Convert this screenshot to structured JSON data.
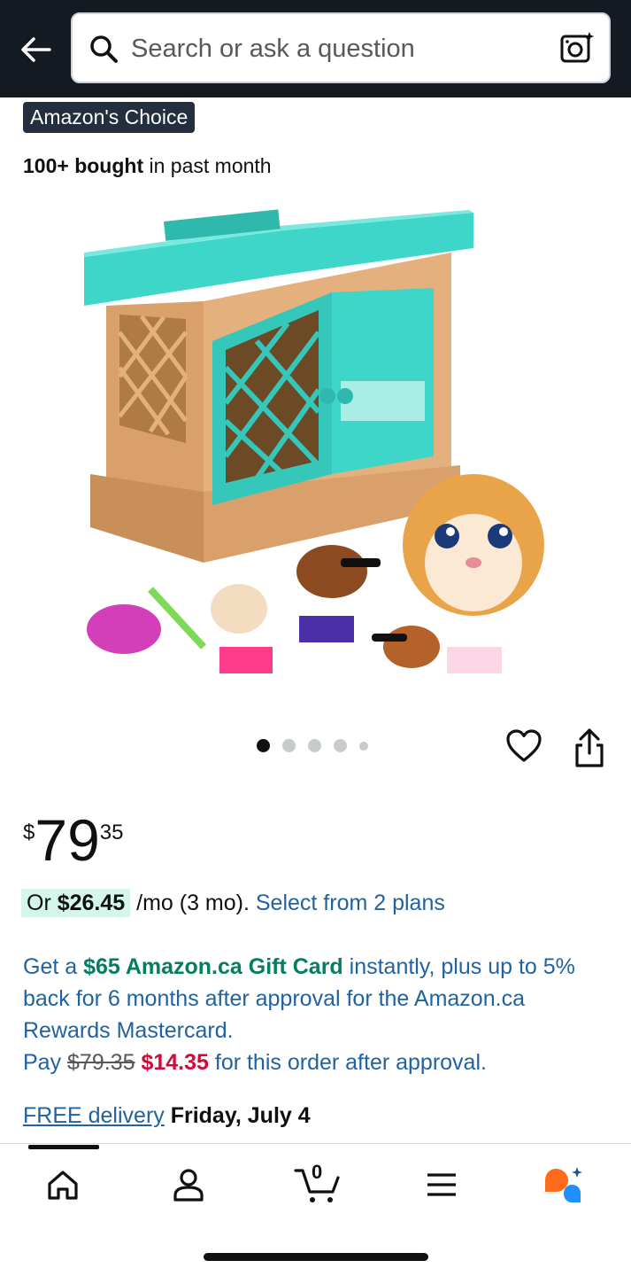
{
  "header": {
    "search_placeholder": "Search or ask a question",
    "background": "#131a22"
  },
  "product": {
    "badge": "Amazon's Choice",
    "bought_strong": "100+ bought",
    "bought_rest": " in past month",
    "image_alt": "Toy guinea pig hutch playset with plush guinea pigs and accessories",
    "carousel": {
      "total": 5,
      "active": 1
    }
  },
  "price": {
    "currency": "$",
    "whole": "79",
    "fraction": "35"
  },
  "installment": {
    "prefix": "Or ",
    "amount": "$26.45",
    "suffix": " /mo (3 mo). ",
    "link": "Select from 2 plans"
  },
  "promo": {
    "get_a": "Get a ",
    "gift_card": "$65 Amazon.ca Gift Card",
    "rest": " instantly, plus up to 5% back for 6 months after approval for the Amazon.ca Rewards Mastercard.",
    "pay": "Pay ",
    "old_price": "$79.35",
    "new_price": "$14.35",
    "pay_rest": " for this order after approval."
  },
  "delivery": {
    "free_label": "FREE delivery",
    "date": "Friday, July 4"
  },
  "bottom_nav": {
    "cart_count": "0",
    "items": [
      "home-icon",
      "account-icon",
      "cart-icon",
      "menu-icon",
      "rufus-icon"
    ]
  },
  "colors": {
    "link": "#2162a1",
    "green": "#067d62",
    "red": "#cc0c39",
    "teal": "#3ed6c9"
  }
}
